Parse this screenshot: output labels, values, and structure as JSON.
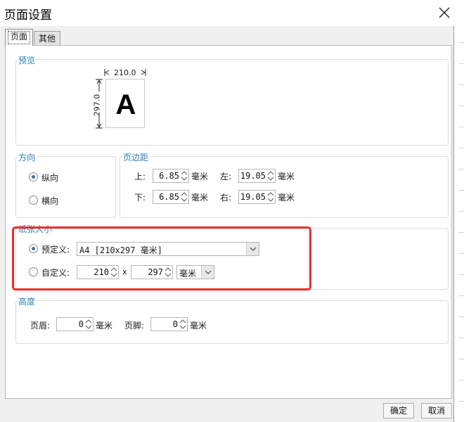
{
  "window": {
    "title": "页面设置"
  },
  "tabs": [
    {
      "label": "页面",
      "active": true
    },
    {
      "label": "其他",
      "active": false
    }
  ],
  "preview": {
    "label": "预览",
    "width_text": "210.0",
    "height_text": "297.0",
    "letter": "A"
  },
  "orientation": {
    "label": "方向",
    "portrait": "纵向",
    "landscape": "横向",
    "selected": "portrait"
  },
  "margins": {
    "label": "页边距",
    "top_label": "上:",
    "top_value": "6.85",
    "left_label": "左:",
    "left_value": "19.05",
    "bottom_label": "下:",
    "bottom_value": "6.85",
    "right_label": "右:",
    "right_value": "19.05",
    "unit": "毫米"
  },
  "paper": {
    "label": "纸张大小",
    "preset_label": "预定义:",
    "preset_value": "A4 [210x297 毫米]",
    "custom_label": "自定义:",
    "custom_width": "210",
    "times": "x",
    "custom_height": "297",
    "custom_unit": "毫米",
    "selected": "preset"
  },
  "height": {
    "label": "高度",
    "header_label": "页眉:",
    "header_value": "0",
    "footer_label": "页脚:",
    "footer_value": "0",
    "unit": "毫米"
  },
  "buttons": {
    "ok": "确定",
    "cancel": "取消"
  },
  "colors": {
    "accent_label": "#2e7fb8",
    "highlight": "#ee2a2a",
    "radio_dot": "#3c6fb3"
  }
}
